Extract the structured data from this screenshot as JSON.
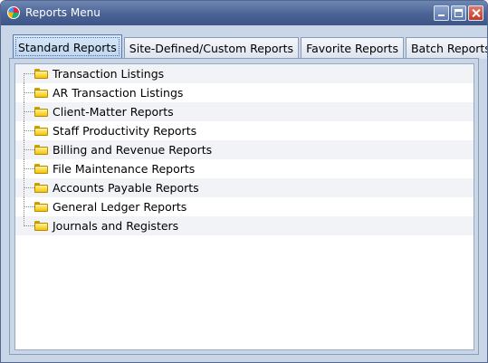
{
  "window": {
    "title": "Reports Menu"
  },
  "tabs": [
    {
      "label": "Standard Reports",
      "active": true
    },
    {
      "label": "Site-Defined/Custom Reports",
      "active": false
    },
    {
      "label": "Favorite Reports",
      "active": false
    },
    {
      "label": "Batch Reports",
      "active": false
    }
  ],
  "tree": {
    "items": [
      {
        "label": "Transaction Listings",
        "icon": "folder-icon"
      },
      {
        "label": "AR Transaction Listings",
        "icon": "folder-icon"
      },
      {
        "label": "Client-Matter Reports",
        "icon": "folder-icon"
      },
      {
        "label": "Staff Productivity Reports",
        "icon": "folder-icon"
      },
      {
        "label": "Billing and Revenue Reports",
        "icon": "folder-icon"
      },
      {
        "label": "File Maintenance Reports",
        "icon": "folder-icon"
      },
      {
        "label": "Accounts Payable Reports",
        "icon": "folder-icon"
      },
      {
        "label": "General Ledger Reports",
        "icon": "folder-icon"
      },
      {
        "label": "Journals and Registers",
        "icon": "folder-icon"
      }
    ]
  }
}
